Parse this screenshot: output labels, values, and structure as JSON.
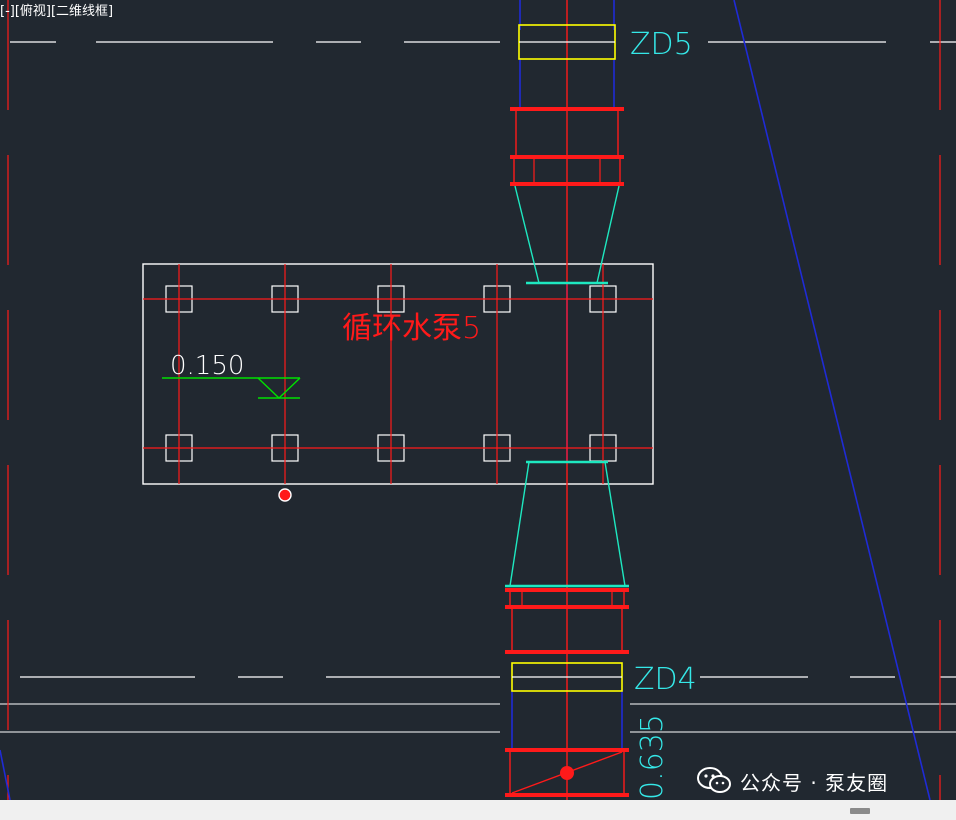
{
  "viewport": {
    "label": "[-][俯视][二维线框]"
  },
  "drawing": {
    "pump_label": "循环水泵5",
    "elevation_top": "0.150",
    "elevation_bottom": "0.635",
    "support_top": "ZD5",
    "support_bottom": "ZD4"
  },
  "colors": {
    "background": "#212830",
    "red": "#ff1a1a",
    "white": "#ffffff",
    "yellow": "#ffff00",
    "cyan": "#35e8e8",
    "green": "#00e000",
    "blue": "#1f2bd6",
    "teal": "#1ee8c0"
  },
  "watermark": {
    "text": "公众号 · 泵友圈",
    "icon": "wechat-icon"
  }
}
